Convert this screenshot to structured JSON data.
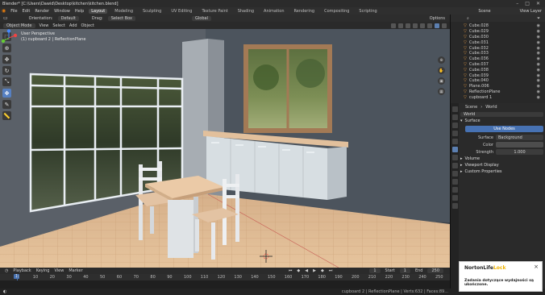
{
  "window": {
    "title": "Blender* [C:\\Users\\Dawid\\Desktop\\kitchen\\kitchen.blend]",
    "controls": [
      "–",
      "□",
      "✕"
    ]
  },
  "menubar": {
    "items": [
      "File",
      "Edit",
      "Render",
      "Window",
      "Help"
    ],
    "workspaces": [
      "Layout",
      "Modeling",
      "Sculpting",
      "UV Editing",
      "Texture Paint",
      "Shading",
      "Animation",
      "Rendering",
      "Compositing",
      "Scripting"
    ],
    "active_workspace": "Layout",
    "scene": "Scene",
    "view_layer": "View Layer"
  },
  "toolheader": {
    "orientation_label": "Orientation:",
    "orientation_value": "Default",
    "drag_label": "Drag:",
    "drag_value": "Select Box",
    "transform_value": "Global",
    "options": "Options"
  },
  "modeheader": {
    "mode": "Object Mode",
    "view": "View",
    "select": "Select",
    "add": "Add",
    "object": "Object"
  },
  "viewport": {
    "view_name": "User Perspective",
    "collection": "(1) cupboard 2 | ReflectionPlane"
  },
  "outliner": {
    "items": [
      {
        "name": "Cube.028"
      },
      {
        "name": "Cube.029"
      },
      {
        "name": "Cube.030"
      },
      {
        "name": "Cube.031"
      },
      {
        "name": "Cube.032"
      },
      {
        "name": "Cube.033"
      },
      {
        "name": "Cube.036"
      },
      {
        "name": "Cube.037"
      },
      {
        "name": "Cube.038"
      },
      {
        "name": "Cube.039"
      },
      {
        "name": "Cube.040"
      },
      {
        "name": "Plane.006"
      },
      {
        "name": "ReflectionPlane"
      },
      {
        "name": "cupboard 1"
      }
    ]
  },
  "properties": {
    "scene_tab": "Scene",
    "world_tab": "World",
    "world_name": "World",
    "surface_section": "Surface",
    "use_nodes": "Use Nodes",
    "surface_label": "Surface",
    "surface_value": "Background",
    "color_label": "Color",
    "strength_label": "Strength",
    "strength_value": "1.000",
    "volume_section": "Volume",
    "viewport_display": "Viewport Display",
    "custom_properties": "Custom Properties"
  },
  "timeline": {
    "playback": "Playback",
    "keying": "Keying",
    "view": "View",
    "marker": "Marker",
    "current_frame": "1",
    "start_label": "Start",
    "start_value": "1",
    "end_label": "End",
    "end_value": "250",
    "ticks": [
      "0",
      "10",
      "20",
      "30",
      "40",
      "50",
      "60",
      "70",
      "80",
      "90",
      "100",
      "110",
      "120",
      "130",
      "140",
      "150",
      "160",
      "170",
      "180",
      "190",
      "200",
      "210",
      "220",
      "230",
      "240",
      "250"
    ]
  },
  "statusbar": {
    "stats": "cupboard 2 | ReflectionPlane | Verts:632 | Faces:89..."
  },
  "toast": {
    "brand_main": "NortonLife",
    "brand_accent": "Lock",
    "close": "×",
    "message": "Zadania dotyczące wydajności są ukończone."
  }
}
